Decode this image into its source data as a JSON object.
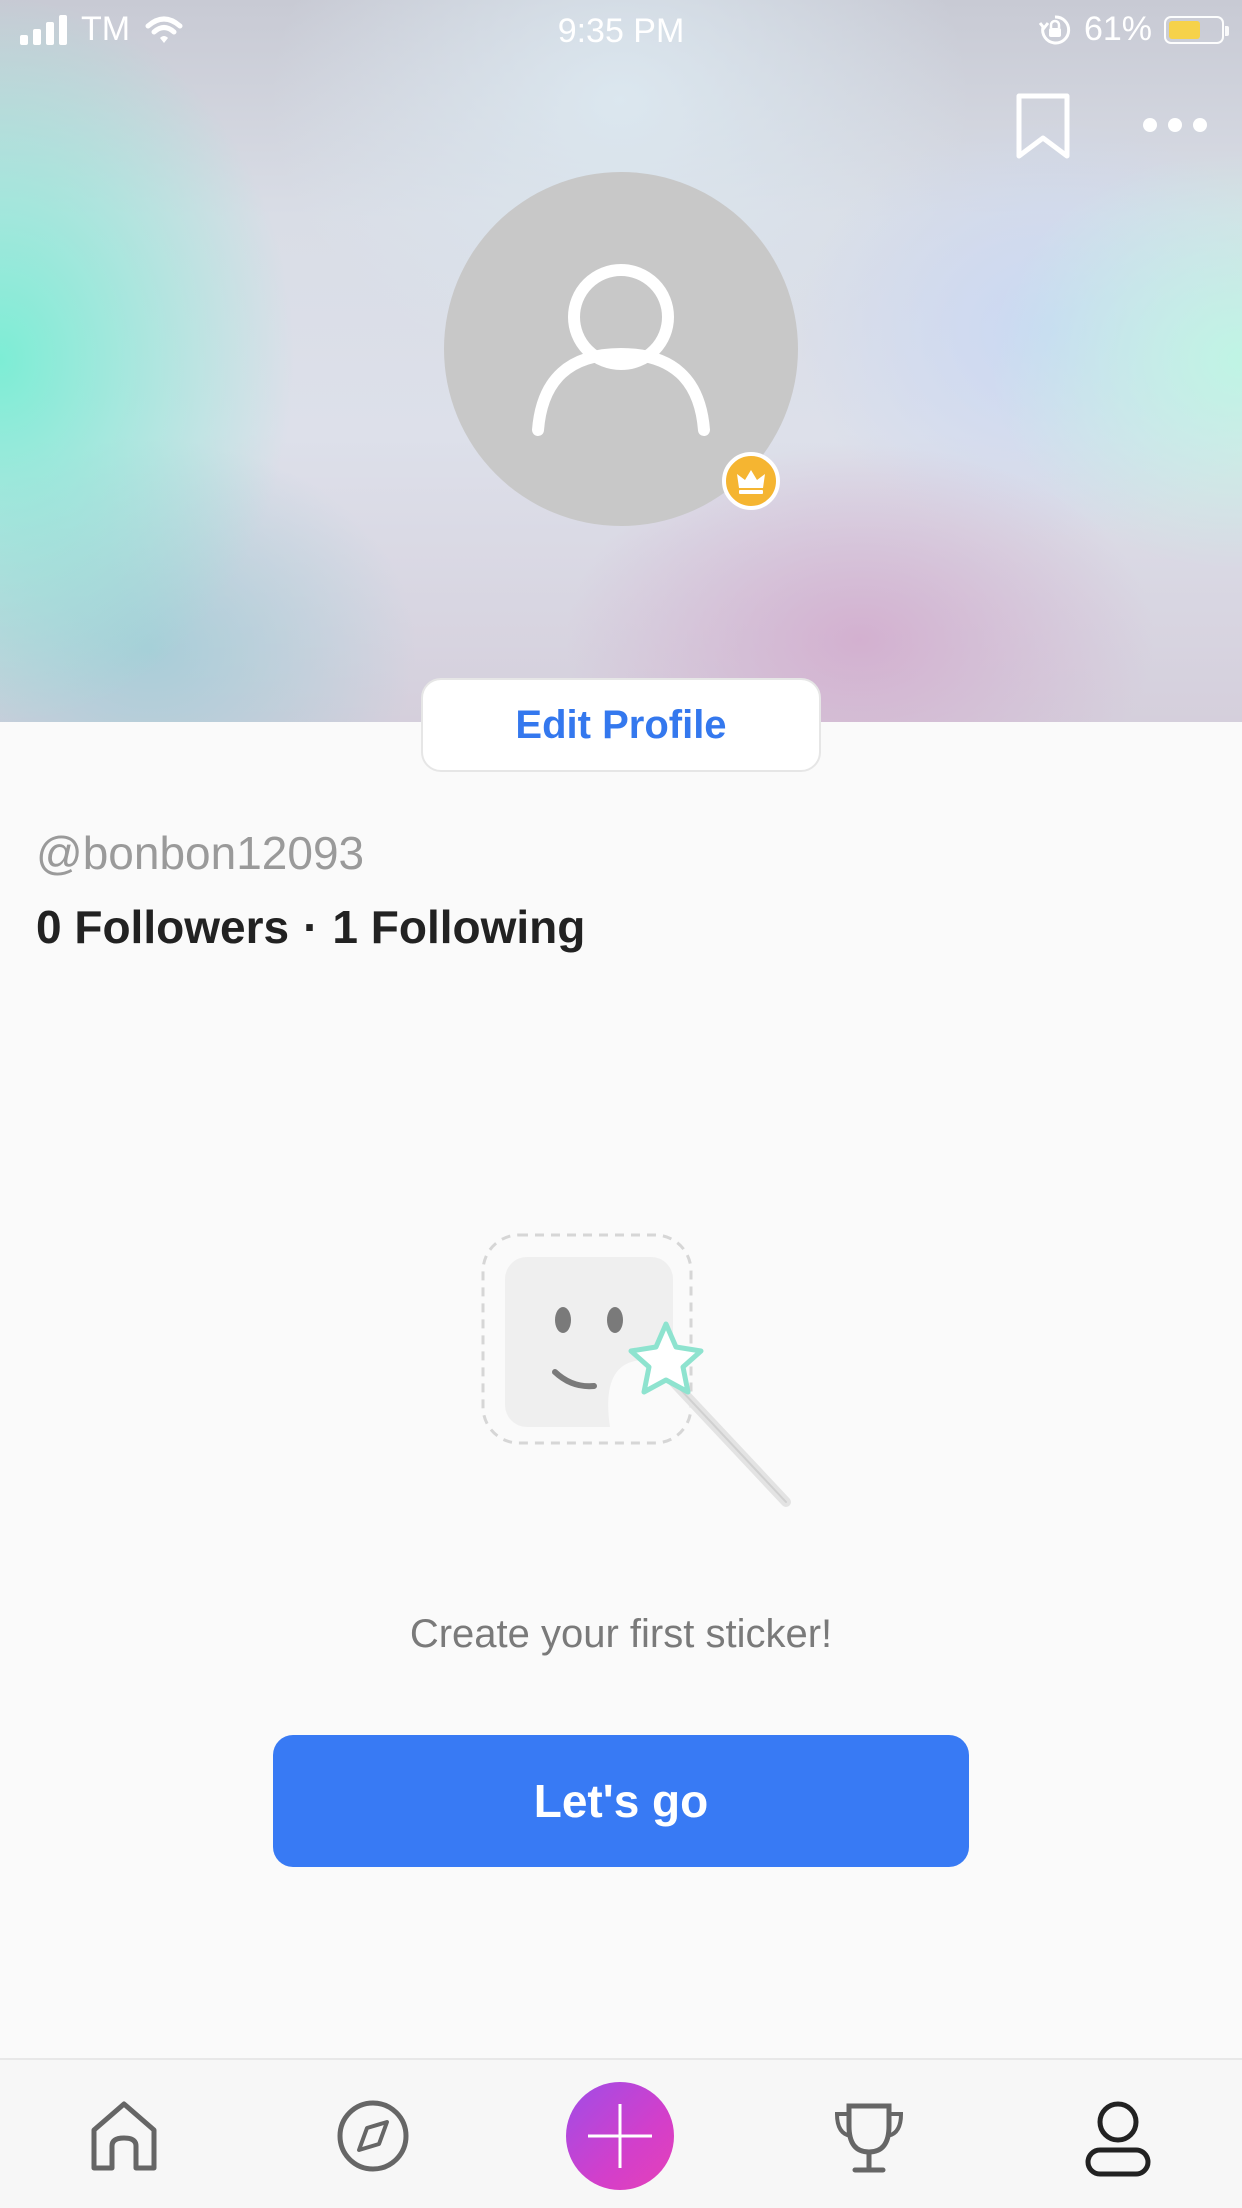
{
  "status_bar": {
    "carrier": "TM",
    "time": "9:35 PM",
    "battery_percent": "61%",
    "battery_level": 0.61
  },
  "header": {
    "bookmark_icon": "bookmark-icon",
    "more_icon": "more-icon",
    "avatar_icon": "user-placeholder-icon",
    "badge_icon": "crown-icon",
    "edit_profile_label": "Edit Profile"
  },
  "profile": {
    "username": "@bonbon12093",
    "followers": "0 Followers",
    "separator": "·",
    "following": "1 Following"
  },
  "empty_state": {
    "illustration": "sticker-magic-wand-icon",
    "message": "Create your first sticker!",
    "button_label": "Let's go"
  },
  "tab_bar": {
    "items": [
      {
        "icon": "home-icon"
      },
      {
        "icon": "compass-icon"
      },
      {
        "icon": "plus-icon"
      },
      {
        "icon": "trophy-icon"
      },
      {
        "icon": "profile-icon"
      }
    ]
  },
  "colors": {
    "accent": "#387af4",
    "edit_text": "#3478ee",
    "crown_badge": "#f5b531",
    "create_gradient_start": "#9f4de7",
    "create_gradient_end": "#e640b8"
  }
}
